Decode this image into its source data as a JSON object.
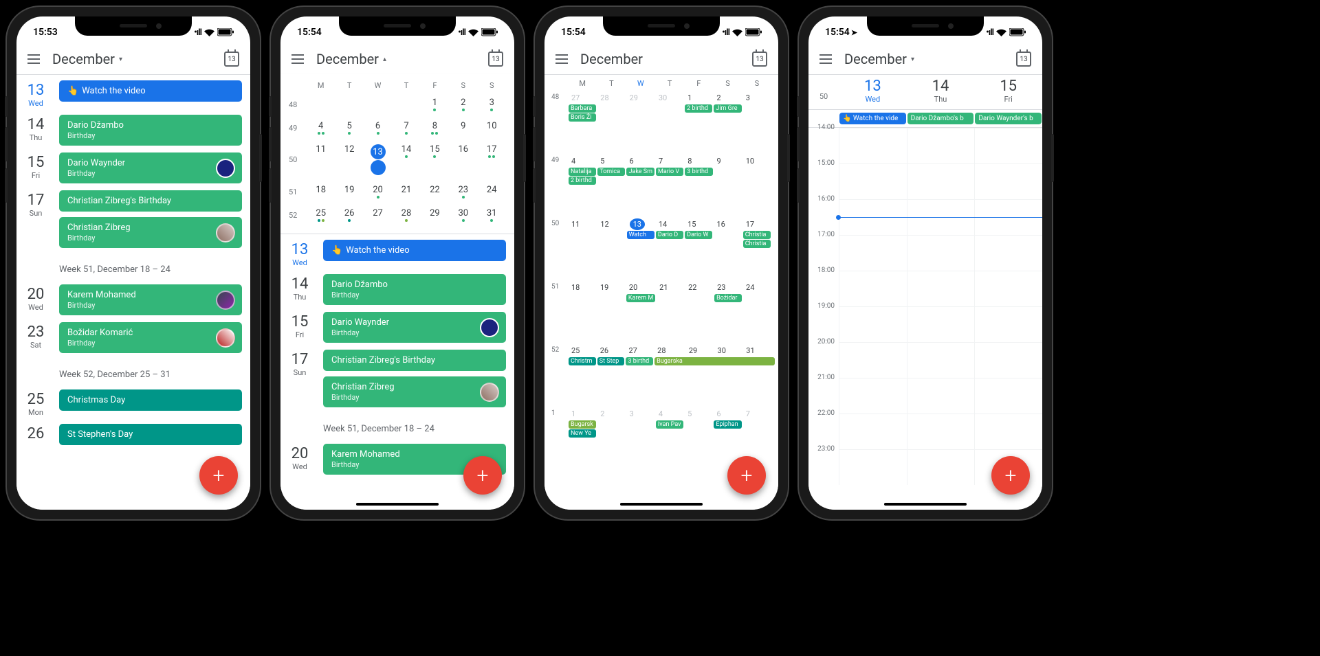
{
  "phones": [
    {
      "time": "15:53",
      "month": "December",
      "arrow": "▾",
      "today_badge": "13",
      "location": false
    },
    {
      "time": "15:54",
      "month": "December",
      "arrow": "▴",
      "today_badge": "13",
      "location": false
    },
    {
      "time": "15:54",
      "month": "December",
      "arrow": "",
      "today_badge": "13",
      "location": false
    },
    {
      "time": "15:54",
      "month": "December",
      "arrow": "▾",
      "today_badge": "13",
      "location": true
    }
  ],
  "schedule": [
    {
      "d": "13",
      "w": "Wed",
      "today": true,
      "evs": [
        {
          "t": "Watch the video",
          "c": "blue",
          "ptr": true
        }
      ]
    },
    {
      "d": "14",
      "w": "Thu",
      "evs": [
        {
          "t": "Dario Džambo",
          "s": "Birthday",
          "c": "green"
        }
      ]
    },
    {
      "d": "15",
      "w": "Fri",
      "evs": [
        {
          "t": "Dario Waynder",
          "s": "Birthday",
          "c": "green",
          "icon": "navy"
        }
      ]
    },
    {
      "d": "17",
      "w": "Sun",
      "evs": [
        {
          "t": "Christian Zibreg's Birthday",
          "c": "green"
        },
        {
          "t": "Christian Zibreg",
          "s": "Birthday",
          "c": "green",
          "icon": "photo1"
        }
      ]
    },
    {
      "label": "Week 51, December 18 – 24"
    },
    {
      "d": "20",
      "w": "Wed",
      "evs": [
        {
          "t": "Karem Mohamed",
          "s": "Birthday",
          "c": "green",
          "icon": "photo2"
        }
      ]
    },
    {
      "d": "23",
      "w": "Sat",
      "evs": [
        {
          "t": "Božidar Komarić",
          "s": "Birthday",
          "c": "green",
          "icon": "photo3"
        }
      ]
    },
    {
      "label": "Week 52, December 25 – 31"
    },
    {
      "d": "25",
      "w": "Mon",
      "evs": [
        {
          "t": "Christmas Day",
          "c": "teal"
        }
      ]
    },
    {
      "d": "26",
      "w": "",
      "evs": [
        {
          "t": "St Stephen's Day",
          "c": "teal"
        }
      ]
    }
  ],
  "schedule2": [
    {
      "d": "13",
      "w": "Wed",
      "today": true,
      "evs": [
        {
          "t": "Watch the video",
          "c": "blue",
          "ptr": true
        }
      ]
    },
    {
      "d": "14",
      "w": "Thu",
      "evs": [
        {
          "t": "Dario Džambo",
          "s": "Birthday",
          "c": "green"
        }
      ]
    },
    {
      "d": "15",
      "w": "Fri",
      "evs": [
        {
          "t": "Dario Waynder",
          "s": "Birthday",
          "c": "green",
          "icon": "navy"
        }
      ]
    },
    {
      "d": "17",
      "w": "Sun",
      "evs": [
        {
          "t": "Christian Zibreg's Birthday",
          "c": "green"
        },
        {
          "t": "Christian Zibreg",
          "s": "Birthday",
          "c": "green",
          "icon": "photo1"
        }
      ]
    },
    {
      "label": "Week 51, December 18 – 24"
    },
    {
      "d": "20",
      "w": "Wed",
      "evs": [
        {
          "t": "Karem Mohamed",
          "s": "Birthday",
          "c": "green"
        }
      ]
    }
  ],
  "mini": {
    "dow": [
      "M",
      "T",
      "W",
      "T",
      "F",
      "S",
      "S"
    ],
    "weeks": [
      {
        "n": "48",
        "d": [
          "",
          "",
          "",
          "",
          "1",
          "2",
          "3"
        ],
        "dots": {
          "4": [
            "g"
          ],
          "5": [
            "g"
          ],
          "6": [
            "g"
          ]
        }
      },
      {
        "n": "49",
        "d": [
          "4",
          "5",
          "6",
          "7",
          "8",
          "9",
          "10"
        ],
        "dots": {
          "0": [
            "g",
            "g"
          ],
          "1": [
            "g"
          ],
          "2": [
            "g"
          ],
          "3": [
            "g"
          ],
          "4": [
            "g",
            "g"
          ],
          "5": [],
          "6": []
        }
      },
      {
        "n": "50",
        "d": [
          "11",
          "12",
          "13",
          "14",
          "15",
          "16",
          "17"
        ],
        "today": 2,
        "dots": {
          "0": [],
          "1": [],
          "2": [
            "b"
          ],
          "3": [
            "g"
          ],
          "4": [
            "g"
          ],
          "5": [],
          "6": [
            "g",
            "g"
          ]
        }
      },
      {
        "n": "51",
        "d": [
          "18",
          "19",
          "20",
          "21",
          "22",
          "23",
          "24"
        ],
        "dots": {
          "2": [
            "g"
          ],
          "5": [
            "g"
          ]
        }
      },
      {
        "n": "52",
        "d": [
          "25",
          "26",
          "27",
          "28",
          "29",
          "30",
          "31"
        ],
        "dots": {
          "0": [
            "t",
            "l"
          ],
          "1": [
            "t"
          ],
          "2": [],
          "3": [
            "l"
          ],
          "4": [],
          "5": [
            "g"
          ],
          "6": [
            "g"
          ]
        }
      }
    ]
  },
  "monthview": {
    "dow": [
      "M",
      "T",
      "W",
      "T",
      "F",
      "S",
      "S"
    ],
    "today_col": 2,
    "weeks": [
      {
        "n": "48",
        "days": [
          {
            "d": "27",
            "o": true,
            "ch": [
              {
                "t": "Barbara",
                "c": "g"
              },
              {
                "t": "Boris Ži",
                "c": "g"
              }
            ]
          },
          {
            "d": "28",
            "o": true
          },
          {
            "d": "29",
            "o": true
          },
          {
            "d": "30",
            "o": true
          },
          {
            "d": "1",
            "ch": [
              {
                "t": "2 birthd",
                "c": "g"
              }
            ]
          },
          {
            "d": "2",
            "ch": [
              {
                "t": "Jim Gre",
                "c": "g"
              }
            ]
          },
          {
            "d": "3"
          }
        ]
      },
      {
        "n": "49",
        "days": [
          {
            "d": "4",
            "ch": [
              {
                "t": "Natalija",
                "c": "g"
              },
              {
                "t": "2 birthd",
                "c": "g"
              }
            ]
          },
          {
            "d": "5",
            "ch": [
              {
                "t": "Tomica",
                "c": "g"
              }
            ]
          },
          {
            "d": "6",
            "ch": [
              {
                "t": "Jake Sm",
                "c": "g"
              }
            ]
          },
          {
            "d": "7",
            "ch": [
              {
                "t": "Mario V",
                "c": "g"
              }
            ]
          },
          {
            "d": "8",
            "ch": [
              {
                "t": "3 birthd",
                "c": "g"
              }
            ]
          },
          {
            "d": "9"
          },
          {
            "d": "10"
          }
        ]
      },
      {
        "n": "50",
        "days": [
          {
            "d": "11"
          },
          {
            "d": "12"
          },
          {
            "d": "13",
            "today": true,
            "ch": [
              {
                "t": "Watch",
                "c": "b"
              }
            ]
          },
          {
            "d": "14",
            "ch": [
              {
                "t": "Dario D",
                "c": "g"
              }
            ]
          },
          {
            "d": "15",
            "ch": [
              {
                "t": "Dario W",
                "c": "g"
              }
            ]
          },
          {
            "d": "16"
          },
          {
            "d": "17",
            "ch": [
              {
                "t": "Christia",
                "c": "g"
              },
              {
                "t": "Christia",
                "c": "g"
              }
            ]
          }
        ]
      },
      {
        "n": "51",
        "days": [
          {
            "d": "18"
          },
          {
            "d": "19"
          },
          {
            "d": "20",
            "ch": [
              {
                "t": "Karem M",
                "c": "g"
              }
            ]
          },
          {
            "d": "21"
          },
          {
            "d": "22"
          },
          {
            "d": "23",
            "ch": [
              {
                "t": "Božidar",
                "c": "g"
              }
            ]
          },
          {
            "d": "24"
          }
        ]
      },
      {
        "n": "52",
        "days": [
          {
            "d": "25",
            "ch": [
              {
                "t": "Christm",
                "c": "t"
              }
            ]
          },
          {
            "d": "26",
            "ch": [
              {
                "t": "St Step",
                "c": "t"
              }
            ]
          },
          {
            "d": "27",
            "ch": [
              {
                "t": "3 birthd",
                "c": "g"
              }
            ]
          },
          {
            "d": "28",
            "ch": [
              {
                "t": "Bugarska",
                "c": "l",
                "span": 4
              }
            ]
          },
          {
            "d": "29"
          },
          {
            "d": "30"
          },
          {
            "d": "31"
          }
        ]
      },
      {
        "n": "1",
        "days": [
          {
            "d": "1",
            "o": true,
            "ch": [
              {
                "t": "Bugarsk",
                "c": "l"
              },
              {
                "t": "New Ye",
                "c": "t"
              }
            ]
          },
          {
            "d": "2",
            "o": true
          },
          {
            "d": "3",
            "o": true
          },
          {
            "d": "4",
            "o": true,
            "ch": [
              {
                "t": "Ivan Pav",
                "c": "g"
              }
            ]
          },
          {
            "d": "5",
            "o": true
          },
          {
            "d": "6",
            "o": true,
            "ch": [
              {
                "t": "Epiphan",
                "c": "t"
              }
            ]
          },
          {
            "d": "7",
            "o": true
          }
        ]
      }
    ]
  },
  "day3": {
    "wk": "50",
    "days": [
      {
        "d": "13",
        "w": "Wed",
        "today": true,
        "allday": {
          "t": "Watch the vide",
          "c": "b",
          "ptr": true
        }
      },
      {
        "d": "14",
        "w": "Thu",
        "allday": {
          "t": "Dario Džambo's b",
          "c": "g"
        }
      },
      {
        "d": "15",
        "w": "Fri",
        "allday": {
          "t": "Dario Waynder's b",
          "c": "g"
        }
      }
    ],
    "hours": [
      "14:00",
      "15:00",
      "16:00",
      "17:00",
      "18:00",
      "19:00",
      "20:00",
      "21:00",
      "22:00",
      "23:00"
    ]
  }
}
